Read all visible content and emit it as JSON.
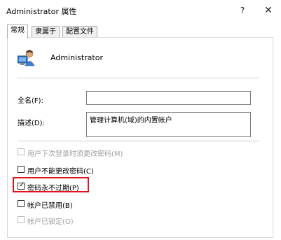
{
  "window": {
    "title": "Administrator 属性",
    "help_glyph": "?",
    "close_glyph": "✕"
  },
  "tabs": [
    {
      "label": "常规",
      "active": true
    },
    {
      "label": "隶属于",
      "active": false
    },
    {
      "label": "配置文件",
      "active": false
    }
  ],
  "user": {
    "name": "Administrator",
    "icon": "user-account-icon"
  },
  "fields": {
    "fullname_label": "全名(F):",
    "fullname_value": "",
    "description_label": "描述(D):",
    "description_value": "管理计算机(域)的内置帐户"
  },
  "checkboxes": [
    {
      "label": "用户下次登录时须更改密码(M)",
      "checked": false,
      "enabled": false
    },
    {
      "label": "用户不能更改密码(C)",
      "checked": false,
      "enabled": true
    },
    {
      "label": "密码永不过期(P)",
      "checked": true,
      "enabled": true
    },
    {
      "label": "帐户已禁用(B)",
      "checked": false,
      "enabled": true
    },
    {
      "label": "帐户已锁定(O)",
      "checked": false,
      "enabled": false
    }
  ],
  "colors": {
    "highlight_border": "#e0141e"
  },
  "checkmark_glyph": "✓"
}
